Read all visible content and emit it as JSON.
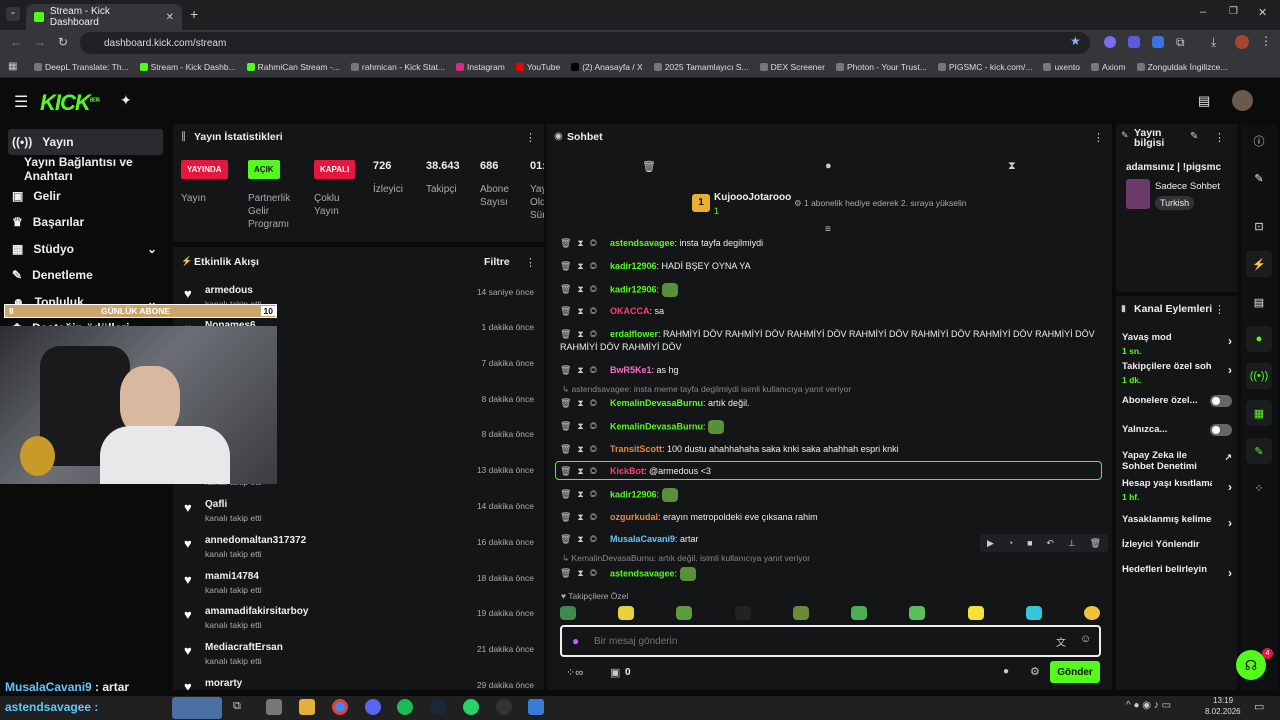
{
  "browser": {
    "tab_title": "Stream - Kick Dashboard",
    "url": "dashboard.kick.com/stream",
    "new_tab": "+"
  },
  "bookmarks": [
    "DeepL Translate: Th...",
    "Stream - Kick Dashb...",
    "RahmiCan Stream -...",
    "rahmican - Kick Stat...",
    "Instagram",
    "YouTube",
    "(2) Anasayfa / X",
    "2025 Tamamlayıcı S...",
    "DEX Screener",
    "Photon - Your Trust...",
    "PIGSMC - kick.com/...",
    "uxento",
    "Axiom",
    "Zonguldak İngilizce..."
  ],
  "brand": {
    "logo": "KICK",
    "beta": "BETA"
  },
  "sidebar": {
    "items": [
      "Yayın",
      "Yayın Bağlantısı ve Anahtarı",
      "Gelir",
      "Başarılar",
      "Stüdyo",
      "Denetleme",
      "Topluluk",
      "Desteğin ödülleri"
    ]
  },
  "overlay": {
    "goal_label": "GÜNLÜK ABONE",
    "goal_left": "8",
    "goal_right": "10",
    "chat_line_user": "MusalaCavani9",
    "chat_line_text": " : artar",
    "chat_line2": "astendsavagee :"
  },
  "stats": {
    "title": "Yayın İstatistikleri",
    "badges": [
      {
        "badge": "YAYINDA",
        "label": "Yayın",
        "color": "#e5173f"
      },
      {
        "badge": "AÇIK",
        "label": "Partnerlik Gelir Programı",
        "color": "#53fc18"
      },
      {
        "badge": "KAPALI",
        "label": "Çoklu Yayın",
        "color": "#e5173f"
      }
    ],
    "numbers": [
      {
        "value": "726",
        "label": "İzleyici"
      },
      {
        "value": "38.643",
        "label": "Takipçi"
      },
      {
        "value": "686",
        "label": "Abone Sayısı"
      },
      {
        "value": "01:",
        "label": "Yayı Old Süre"
      }
    ]
  },
  "activity": {
    "title": "Etkinlik Akışı",
    "filter": "Filtre",
    "items": [
      {
        "name": "armedous",
        "sub": "kanalı takip etti",
        "time": "14 saniye önce"
      },
      {
        "name": "Nonames6",
        "sub": "",
        "time": "1 dakika önce"
      },
      {
        "name": "DANGIREYIM",
        "sub": "",
        "time": "7 dakika önce"
      },
      {
        "name": "",
        "sub": "",
        "time": "8 dakika önce"
      },
      {
        "name": "",
        "sub": "",
        "time": "8 dakika önce"
      },
      {
        "name": "",
        "sub": "kanalı takip etti",
        "time": "13 dakika önce"
      },
      {
        "name": "Qafli",
        "sub": "kanalı takip etti",
        "time": "14 dakika önce"
      },
      {
        "name": "annedomaltan317372",
        "sub": "kanalı takip etti",
        "time": "16 dakika önce"
      },
      {
        "name": "mami14784",
        "sub": "kanalı takip etti",
        "time": "18 dakika önce"
      },
      {
        "name": "amamadifakirsitarboy",
        "sub": "kanalı takip etti",
        "time": "19 dakika önce"
      },
      {
        "name": "MediacraftErsan",
        "sub": "kanalı takip etti",
        "time": "21 dakika önce"
      },
      {
        "name": "morarty",
        "sub": "",
        "time": "29 dakika önce"
      }
    ]
  },
  "chat": {
    "title": "Sohbet",
    "top_user": "KujoooJotarooo",
    "top_rank": "1",
    "top_badge_count": "1",
    "top_message": "1 abonelik hediye ederek 2. sıraya yükselin",
    "messages": [
      {
        "user": "astendsavagee",
        "text": ": insta",
        "tail": "tayfa degilmiydi",
        "color": "#53fc18"
      },
      {
        "user": "kadir12906",
        "text": ": HADİ BŞEY OYNA YA",
        "tail": "",
        "color": "#53fc18"
      },
      {
        "user": "kadir12906",
        "text": ":",
        "tail": "",
        "color": "#53fc18"
      },
      {
        "user": "OKACCA",
        "text": ": sa",
        "tail": "",
        "color": "#ff3c6e"
      },
      {
        "user": "erdalflower",
        "text": ": RAHMİYİ DÖV RAHMİYİ DÖV RAHMİYİ DÖV RAHMİYİ DÖV RAHMİYİ DÖV RAHMİYİ DÖV",
        "tail": "RAHMİYİ DÖV RAHMİYİ DÖV RAHMİYİ DÖV",
        "color": "#53fc18"
      },
      {
        "user": "BwR5Ke1",
        "text": ": as hg",
        "tail": "",
        "color": "#ff6ec7"
      },
      {
        "user": "KemalinDevasaBurnu",
        "text": ": artık değil.",
        "tail": "",
        "color": "#53fc18"
      },
      {
        "user": "KemalinDevasaBurnu",
        "text": ":",
        "tail": "",
        "color": "#53fc18"
      },
      {
        "user": "TransitScott",
        "text": ": 100 dustu ahahhahaha saka knki saka ahahhah espri knki",
        "tail": "",
        "color": "#e8883c"
      },
      {
        "user": "KickBot",
        "text": ": @armedous <3",
        "tail": "",
        "color": "#ff3c6e"
      },
      {
        "user": "kadir12906",
        "text": ":",
        "tail": "",
        "color": "#53fc18"
      },
      {
        "user": "ozgurkudal",
        "text": ": erayın metropoldeki eve çıksana rahim",
        "tail": "",
        "color": "#e8883c"
      },
      {
        "user": "MusalaCavani9",
        "text": ": artar",
        "tail": "",
        "color": "#5dc8ff"
      },
      {
        "user": "astendsavagee",
        "text": ":",
        "tail": "",
        "color": "#53fc18"
      }
    ],
    "reply1": "astendsavagee: insta meme tayfa degilmiydi isimli kullanıcıya yanıt veriyor",
    "reply2": "KemalinDevasaBurnu: artık değil. isimli kullanıcıya yanıt veriyor",
    "followers_only": "Takipçilere Özel",
    "placeholder": "Bir mesaj gönderin",
    "points": "0",
    "send": "Gönder"
  },
  "info": {
    "title": "Yayın bilgisi",
    "stream_title": "adamsınız | !pigsmc",
    "mode": "Sadece Sohbet",
    "language": "Turkish"
  },
  "actions": {
    "title": "Kanal Eylemleri",
    "items": [
      {
        "label": "Yavaş mod",
        "sub": "1 sn.",
        "kind": "arrow"
      },
      {
        "label": "Takipçilere özel soh",
        "sub": "1 dk.",
        "kind": "arrow"
      },
      {
        "label": "Abonelere özel...",
        "sub": "",
        "kind": "toggle"
      },
      {
        "label": "Yalnızca...",
        "sub": "",
        "kind": "toggle"
      },
      {
        "label": "Yapay Zeka ile Sohbet Denetimi",
        "sub": "",
        "kind": "link"
      },
      {
        "label": "Hesap yaşı kısıtlama",
        "sub": "1 hf.",
        "kind": "arrow"
      },
      {
        "label": "Yasaklanmış kelimel",
        "sub": "",
        "kind": "arrow"
      },
      {
        "label": "İzleyici Yönlendir",
        "sub": "",
        "kind": "none"
      },
      {
        "label": "Hedefleri belirleyin",
        "sub": "",
        "kind": "arrow"
      }
    ]
  },
  "support_badge": "4",
  "clock": {
    "time": "13:19",
    "date": "8.02.2026"
  },
  "colors": {
    "accent": "#53fc18",
    "live": "#e5173f"
  }
}
